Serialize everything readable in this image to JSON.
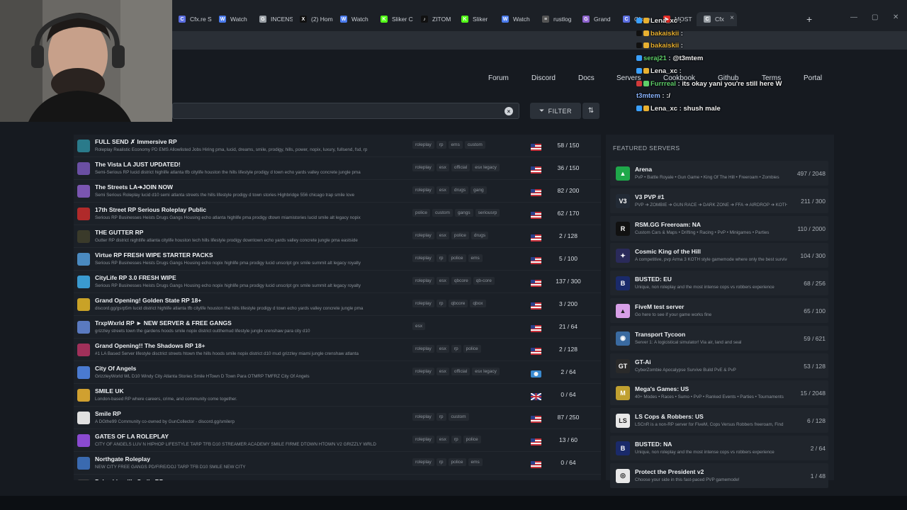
{
  "browser": {
    "tabs": [
      {
        "label": "Cfx.re S",
        "color": "#5b6ee1",
        "glyph": "C"
      },
      {
        "label": "Watch",
        "color": "#4b7bec",
        "glyph": "W"
      },
      {
        "label": "INCENS",
        "color": "#9aa0a6",
        "glyph": "G"
      },
      {
        "label": "(2) Hom",
        "color": "#111111",
        "glyph": "X"
      },
      {
        "label": "Watch",
        "color": "#4b7bec",
        "glyph": "W"
      },
      {
        "label": "Sliker C",
        "color": "#53fc18",
        "glyph": "K"
      },
      {
        "label": "ZITOM",
        "color": "#111111",
        "glyph": "♪"
      },
      {
        "label": "Sliker",
        "color": "#53fc18",
        "glyph": "K"
      },
      {
        "label": "Watch",
        "color": "#4b7bec",
        "glyph": "W"
      },
      {
        "label": "rustlog",
        "color": "#555555",
        "glyph": "≡"
      },
      {
        "label": "Grand",
        "color": "#8e63ce",
        "glyph": "G"
      },
      {
        "label": "Cfx.re",
        "color": "#5b6ee1",
        "glyph": "C"
      },
      {
        "label": "MOST",
        "color": "#e52d27",
        "glyph": "▶"
      },
      {
        "label": "Cfx",
        "color": "#9aa0a6",
        "glyph": "C"
      }
    ],
    "new_tab": "+",
    "close_tab": "×"
  },
  "nav": {
    "items": [
      "Forum",
      "Discord",
      "Docs",
      "Servers",
      "Cookbook",
      "Github",
      "Terms",
      "Portal"
    ]
  },
  "search": {
    "value": "",
    "clear": "×"
  },
  "filter": {
    "label": "FILTER",
    "icon": "filter-icon",
    "sort_icon": "⇅"
  },
  "servers": [
    {
      "name": "FULL SEND ✗ Immersive RP",
      "desc": "Roleplay Realistic Economy PD EMS Allowlisted Jobs Hiring pma, lucid, dreams, smile, prodigy, hills, power, nopix, luxury, fullsend, fsd, rp",
      "tags": [
        "roleplay",
        "rp",
        "ems",
        "custom"
      ],
      "players": "58 / 150",
      "icon": "#2a7a8a",
      "flag": "us"
    },
    {
      "name": "The Vista LA JUST UPDATED!",
      "desc": "Semi-Serious RP lucid district highlife atlanta tfb citylife houston the hills lifestyle prodigy d town echo yards valley concrete jungle pma",
      "tags": [
        "roleplay",
        "esx",
        "official",
        "esx legacy"
      ],
      "players": "36 / 150",
      "icon": "#6a4fa3",
      "flag": "us"
    },
    {
      "name": "The Streets LA➔JOIN NOW",
      "desc": "Semi Serious Roleplay lucid d10 semi atlanta streets the hills lifestyle prodigy d town stories Highbridge 556 chicago trap smile love",
      "tags": [
        "roleplay",
        "esx",
        "drugs",
        "gang"
      ],
      "players": "82 / 200",
      "icon": "#7a55b0",
      "flag": "us"
    },
    {
      "name": "17th Street RP Serious Roleplay Public",
      "desc": "Serious RP Businesses Heists Drugs Gangs Housing echo atlanta highlife pma prodigy dtown miamistories lucid smile alt legacy nopix",
      "tags": [
        "police",
        "custom",
        "gangs",
        "seriousrp"
      ],
      "players": "62 / 170",
      "icon": "#b02a2a",
      "flag": "us"
    },
    {
      "name": "THE GUTTER RP",
      "desc": "Gutter RP district nightlife atlanta citylife houston tech hills lifestyle prodigy downtown echo yards valley concrete jungle pma eastside",
      "tags": [
        "roleplay",
        "esx",
        "police",
        "drugs"
      ],
      "players": "2 / 128",
      "icon": "#3a3a2a",
      "flag": "us"
    },
    {
      "name": "Virtue RP FRESH WIPE STARTER PACKS",
      "desc": "Serious RP Businesses Heists Drugs Gangs Housing echo nopix highlife pma prodigy lucid unscript grx smile summit alt legacy royalty",
      "tags": [
        "roleplay",
        "rp",
        "police",
        "ems"
      ],
      "players": "5 / 100",
      "icon": "#4a8ac0",
      "flag": "us"
    },
    {
      "name": "CityLife RP 3.0 FRESH WIPE",
      "desc": "Serious RP Businesses Heists Drugs Gangs Housing echo nopix highlife pma prodigy lucid unscript grx smile summit alt legacy royalty",
      "tags": [
        "roleplay",
        "esx",
        "qbcore",
        "qb-core"
      ],
      "players": "137 / 300",
      "icon": "#3a9ad0",
      "flag": "us"
    },
    {
      "name": "Grand Opening! Golden State RP 18+",
      "desc": "discord.gg/gsrp5m lucid district highlife atlanta tfb citylife houston the hills lifestyle prodigy d town echo yards valley concrete jungle pma",
      "tags": [
        "roleplay",
        "rp",
        "qbcore",
        "qbox"
      ],
      "players": "3 / 200",
      "icon": "#c9a227",
      "flag": "us"
    },
    {
      "name": "TrxpWxrld RP ► NEW SERVER & FREE GANGS",
      "desc": "grizzley streets town the gardens hoods smile nopix district outthemud lifestyle jungle crenshaw para city d10",
      "tags": [
        "esx"
      ],
      "players": "21 / 64",
      "icon": "#5a7ac0",
      "flag": "us"
    },
    {
      "name": "Grand Opening!! The Shadows RP 18+",
      "desc": "#1 LA Based Server lifestyle disctrict streets htown the hills hoods smile nopix district d10 mud grizzley miami jungle crenshaw atlanta",
      "tags": [
        "roleplay",
        "esx",
        "rp",
        "police"
      ],
      "players": "2 / 128",
      "icon": "#a0305a",
      "flag": "us"
    },
    {
      "name": "City Of Angels",
      "desc": "GrizzleyWorld WL D10 Windy City Atlanta Stories Smile HTown D Town Para OTMRP TMFRZ City Of Angels",
      "tags": [
        "roleplay",
        "esx",
        "official",
        "esx legacy"
      ],
      "players": "2 / 64",
      "icon": "#4a7ad0",
      "flag": "other"
    },
    {
      "name": "SMILE UK",
      "desc": "London-based RP where careers, crime, and community come together.",
      "tags": [],
      "players": "0 / 64",
      "icon": "#d0a030",
      "flag": "uk"
    },
    {
      "name": "Smile RP",
      "desc": "A DGthe99 Community co-owned by GunCollector - discord.gg/smilerp",
      "tags": [
        "roleplay",
        "rp",
        "custom"
      ],
      "players": "87 / 250",
      "icon": "#e0e0e0",
      "flag": "us"
    },
    {
      "name": "GATES OF LA ROLEPLAY",
      "desc": "CITY OF ANGELS LUV N HIPHOP LIFESTYLE TARP TFB D10 STREAMER ACADEMY SMILE FIRME DTOWN HTOWN V2 GRIZZLY WRLD",
      "tags": [
        "roleplay",
        "esx",
        "rp",
        "police"
      ],
      "players": "13 / 60",
      "icon": "#8a4ad0",
      "flag": "us"
    },
    {
      "name": "Northgate Roleplay",
      "desc": "NEW CITY FREE GANGS PD/FIRE/DOJ TARP TFB D10 SMILE NEW CITY",
      "tags": [
        "roleplay",
        "rp",
        "police",
        "ems"
      ],
      "players": "0 / 64",
      "icon": "#3a6ab0",
      "flag": "us"
    },
    {
      "name": "Pakashinerille Smile RP",
      "desc": "",
      "tags": [],
      "players": "",
      "icon": "#444444",
      "flag": "us"
    }
  ],
  "featured": {
    "title": "FEATURED SERVERS",
    "items": [
      {
        "name": "Arena",
        "desc": "PvP • Battle Royale • Gun Game • King Of The Hill • Freeroam • Zombies",
        "players": "497 / 2048",
        "icon": "#1fa84a",
        "glyph": "▲"
      },
      {
        "name": "V3 PVP #1",
        "desc": "PVP ➔ ZOMBIE ➔ GUN RACE ➔ DARK ZONE ➔ FFA ➔ AIRDROP ➔ KOTH",
        "players": "211 / 300",
        "icon": "#222a35",
        "glyph": "V3"
      },
      {
        "name": "RSM.GG Freeroam: NA",
        "desc": "Custom Cars & Maps • Drifting • Racing • PvP • Minigames • Parties",
        "players": "110 / 2000",
        "icon": "#111111",
        "glyph": "R"
      },
      {
        "name": "Cosmic King of the Hill",
        "desc": "A competitive, pvp Arma 3 KOTH style gamemode where only the best survive",
        "players": "104 / 300",
        "icon": "#2a2a5a",
        "glyph": "✦"
      },
      {
        "name": "BUSTED: EU",
        "desc": "Unique, non roleplay and the most intense cops vs robbers experience",
        "players": "68 / 256",
        "icon": "#1a2a6a",
        "glyph": "B"
      },
      {
        "name": "FiveM test server",
        "desc": "Go here to see if your game works fine",
        "players": "65 / 100",
        "icon": "#d8a0e8",
        "glyph": "▲"
      },
      {
        "name": "Transport Tycoon",
        "desc": "Server 1: A logicistical simulator! Via air, land and seal",
        "players": "59 / 621",
        "icon": "#3a6aa0",
        "glyph": "◉"
      },
      {
        "name": "GT-Ai",
        "desc": "CyberZombie Apocalypse Survive Build PvE & PvP",
        "players": "53 / 128",
        "icon": "#2a2a2a",
        "glyph": "GT"
      },
      {
        "name": "Mega's Games: US",
        "desc": "40+ Modes • Races • Sumo • PvP • Ranked Events • Parties • Tournaments",
        "players": "15 / 2048",
        "icon": "#c0a030",
        "glyph": "M"
      },
      {
        "name": "LS Cops & Robbers: US",
        "desc": "LSCnR is a non-RP server for FiveM, Cops Versus Robbers freeroam, Find",
        "players": "6 / 128",
        "icon": "#e8e8e8",
        "glyph": "LS"
      },
      {
        "name": "BUSTED: NA",
        "desc": "Unique, non roleplay and the most intense cops vs robbers experience",
        "players": "2 / 64",
        "icon": "#1a2a6a",
        "glyph": "B"
      },
      {
        "name": "Protect the President v2",
        "desc": "Choose your side in this fast-paced PVP gamemode!",
        "players": "1 / 48",
        "icon": "#e8e8e8",
        "glyph": "◎"
      }
    ]
  },
  "chat": [
    {
      "user": "Lena_xc",
      "msg": "",
      "color": "#e8e8e8",
      "badges": [
        "#3aa0ff",
        "#e8b030"
      ]
    },
    {
      "user": "bakaiskii",
      "msg": "",
      "color": "#e8b030",
      "badges": [
        "#111111",
        "#e8b030"
      ]
    },
    {
      "user": "bakaiskii",
      "msg": "",
      "color": "#e8b030",
      "badges": [
        "#111111",
        "#e8b030"
      ]
    },
    {
      "user": "seraj21",
      "msg": "@t3mtem",
      "color": "#5fd06a",
      "badges": [
        "#3aa0ff"
      ]
    },
    {
      "user": "Lena_xc",
      "msg": "",
      "color": "#e8e8e8",
      "badges": [
        "#3aa0ff",
        "#e8b030"
      ]
    },
    {
      "user": "Furrreal",
      "msg": "its okay yani you're still here W",
      "color": "#5fd06a",
      "badges": [
        "#d03a3a",
        "#5fd06a"
      ]
    },
    {
      "user": "t3mtem",
      "msg": ":/",
      "color": "#8ab4ff",
      "badges": []
    },
    {
      "user": "Lena_xc",
      "msg": "shush male",
      "color": "#e8e8e8",
      "badges": [
        "#3aa0ff",
        "#e8b030"
      ]
    }
  ]
}
